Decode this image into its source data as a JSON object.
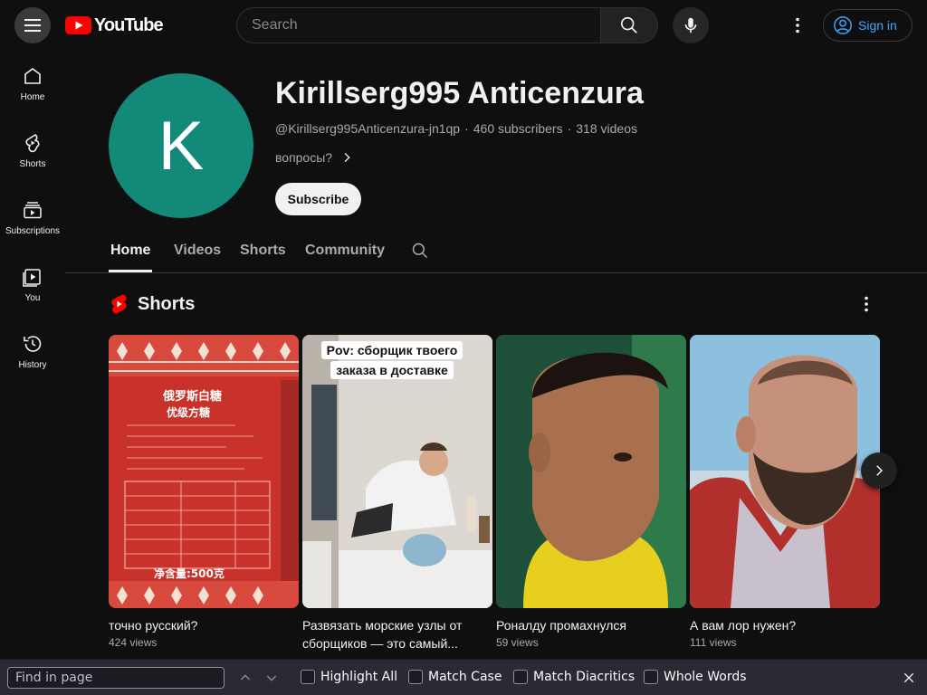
{
  "header": {
    "logo_text": "YouTube",
    "search_placeholder": "Search",
    "sign_in_label": "Sign in"
  },
  "guide": [
    {
      "label": "Home",
      "icon": "home-icon"
    },
    {
      "label": "Shorts",
      "icon": "shorts-icon"
    },
    {
      "label": "Subscriptions",
      "icon": "subscriptions-icon"
    },
    {
      "label": "You",
      "icon": "you-icon"
    },
    {
      "label": "History",
      "icon": "history-icon"
    }
  ],
  "channel": {
    "avatar_letter": "K",
    "avatar_color": "#138a79",
    "name": "Kirillserg995 Anticenzura",
    "handle": "@Kirillserg995Anticenzura-jn1qp",
    "subscribers": "460 subscribers",
    "videos": "318 videos",
    "description": "вопросы?",
    "subscribe_label": "Subscribe"
  },
  "tabs": [
    {
      "label": "Home",
      "active": true
    },
    {
      "label": "Videos",
      "active": false
    },
    {
      "label": "Shorts",
      "active": false
    },
    {
      "label": "Community",
      "active": false
    }
  ],
  "shorts_shelf": {
    "title": "Shorts",
    "items": [
      {
        "title": "точно русский?",
        "views": "424 views"
      },
      {
        "title": "Развязать морские узлы от сборщиков — это самый...",
        "views": "",
        "overlay_line1": "Pov: сборщик твоего",
        "overlay_line2": "заказа в доставке"
      },
      {
        "title": "Роналду промахнулся",
        "views": "59 views"
      },
      {
        "title": "А вам лор нужен?",
        "views": "111 views"
      }
    ],
    "thumb1_text": {
      "line1": "俄罗斯白糖",
      "line2": "优级方糖",
      "weight": "净含量:500克"
    }
  },
  "findbar": {
    "placeholder": "Find in page",
    "highlight_all": "Highlight All",
    "match_case": "Match Case",
    "match_diacritics": "Match Diacritics",
    "whole_words": "Whole Words"
  },
  "colors": {
    "accent_link": "#3ea6ff",
    "youtube_red": "#ff0000",
    "background": "#0f0f0f"
  }
}
